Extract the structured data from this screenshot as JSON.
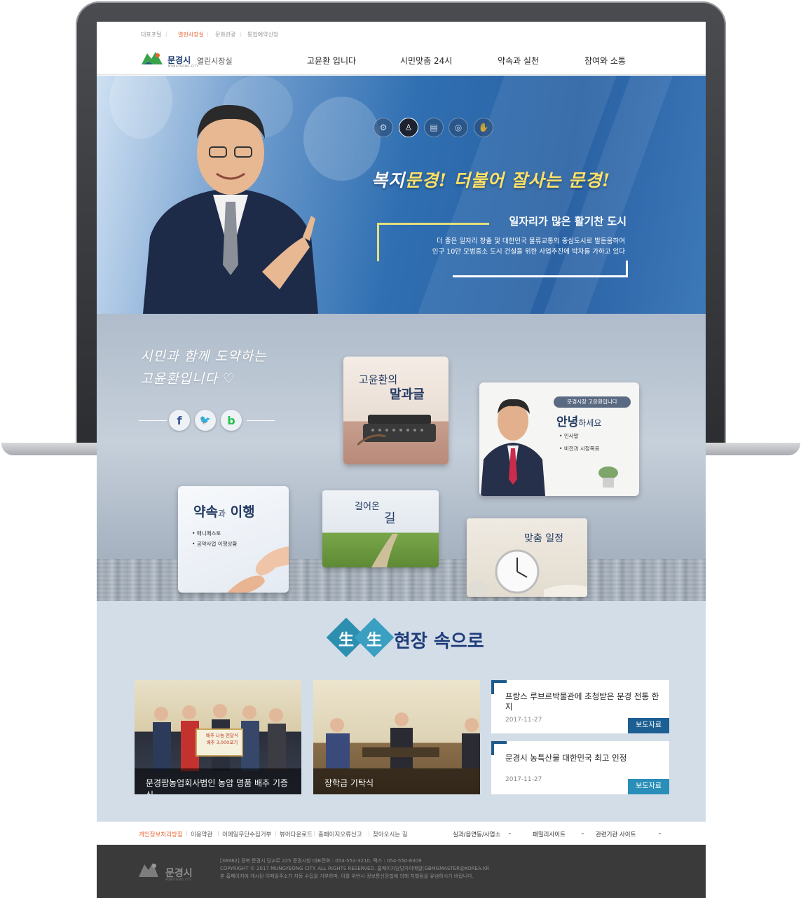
{
  "utility_nav": [
    "대표포털",
    "열린시장실",
    "문화관광",
    "통합예약신청"
  ],
  "utility_active": "열린시장실",
  "logo": {
    "name": "문경시",
    "sub": "MUNGYEONG CITY",
    "section": "열린시장실"
  },
  "main_nav": [
    "고윤환 입니다",
    "시민맞춤 24시",
    "약속과 실천",
    "참여와 소통"
  ],
  "hero": {
    "icons": [
      "gear-icon",
      "person-icon",
      "document-icon",
      "sports-icon",
      "handshake-icon"
    ],
    "active_icon_index": 1,
    "slogan_part1_white": "복지",
    "slogan_part1_yellow": "문경! 더불어 잘사는 ",
    "slogan_part2": "문경!",
    "subtitle": "일자리가 많은 활기찬 도시",
    "desc_line1": "더 좋은 일자리 창출 및 대한민국 물류교통의 중심도시로 발돋움하여",
    "desc_line2": "인구 10만 모범중소 도시 건설을 위한 사업추진에 박차를 가하고 있다"
  },
  "intro": {
    "line1": "시민과 함께 도약하는",
    "line2": "고윤환입니다 ♡"
  },
  "social": [
    {
      "icon": "facebook-icon",
      "glyph": "f",
      "color": "#3b5998"
    },
    {
      "icon": "twitter-icon",
      "glyph": "🐦",
      "color": "#1da1f2"
    },
    {
      "icon": "band-icon",
      "glyph": "b",
      "color": "#27c24c"
    }
  ],
  "cards": {
    "words": {
      "line1": "고윤환의",
      "line2": "말과글"
    },
    "greeting": {
      "badge": "문경시장 고윤환입니다",
      "title_bold": "안녕",
      "title_rest": "하세요",
      "items": [
        "인사말",
        "비전과 시정목표"
      ]
    },
    "promise": {
      "title_a": "약속",
      "title_b": "과",
      "title_c": " 이행",
      "items": [
        "매니페스토",
        "공약사업 이행상황"
      ]
    },
    "road": {
      "line1": "걸어온",
      "line2": "길"
    },
    "schedule": {
      "title": "맞춤 일정"
    }
  },
  "field": {
    "chars": [
      "生",
      "生"
    ],
    "title": "현장 속으로",
    "photos": [
      {
        "caption": "문경팜농업회사법인 농암 명품 배추 기증식",
        "banner_line1": "배추 나눔 전달식",
        "banner_line2": "배추 3,000포기"
      },
      {
        "caption": "장학금 기탁식"
      }
    ],
    "news": [
      {
        "title": "프랑스 루브르박물관에 초청받은 문경 전통 한지",
        "date": "2017-11-27",
        "tag": "보도자료"
      },
      {
        "title": "문경시 농특산물 대한민국 최고 인정",
        "date": "2017-11-27",
        "tag": "보도자료"
      }
    ]
  },
  "footer_links": [
    "개인정보처리방침",
    "이용약관",
    "이메일무단수집거부",
    "뷰어다운로드",
    "홈페이지오류신고",
    "찾아오시는 길"
  ],
  "footer_selects": [
    "실과/읍면동/사업소",
    "패밀리사이트",
    "관련기관 사이트"
  ],
  "footer": {
    "logo": "문경시",
    "logo_sub": "MUNGYEONG CITY",
    "info1": "[36982] 경북 문경시 당교로 225 문경시청    대표전화 : 054-552-3210,     팩스 : 054-550-6309",
    "info2": "COPYRIGHT © 2017 MUNGYEONG CITY.  ALL RIGHTS RESERVED.   홈페이지담당자이메일(GBMGMASTER@KOREA.KR",
    "info3": "본 홈페이지에 게시된 이메일주소가 자동 수집을 거부하며, 이를 위반시 정보통신망법에 의해 처벌됨을 유념하시기 바랍니다."
  },
  "colors": {
    "accent": "#e8632f",
    "brand": "#1f3d7a",
    "teal": "#2d8fb0",
    "tag": "#1c5f93"
  }
}
